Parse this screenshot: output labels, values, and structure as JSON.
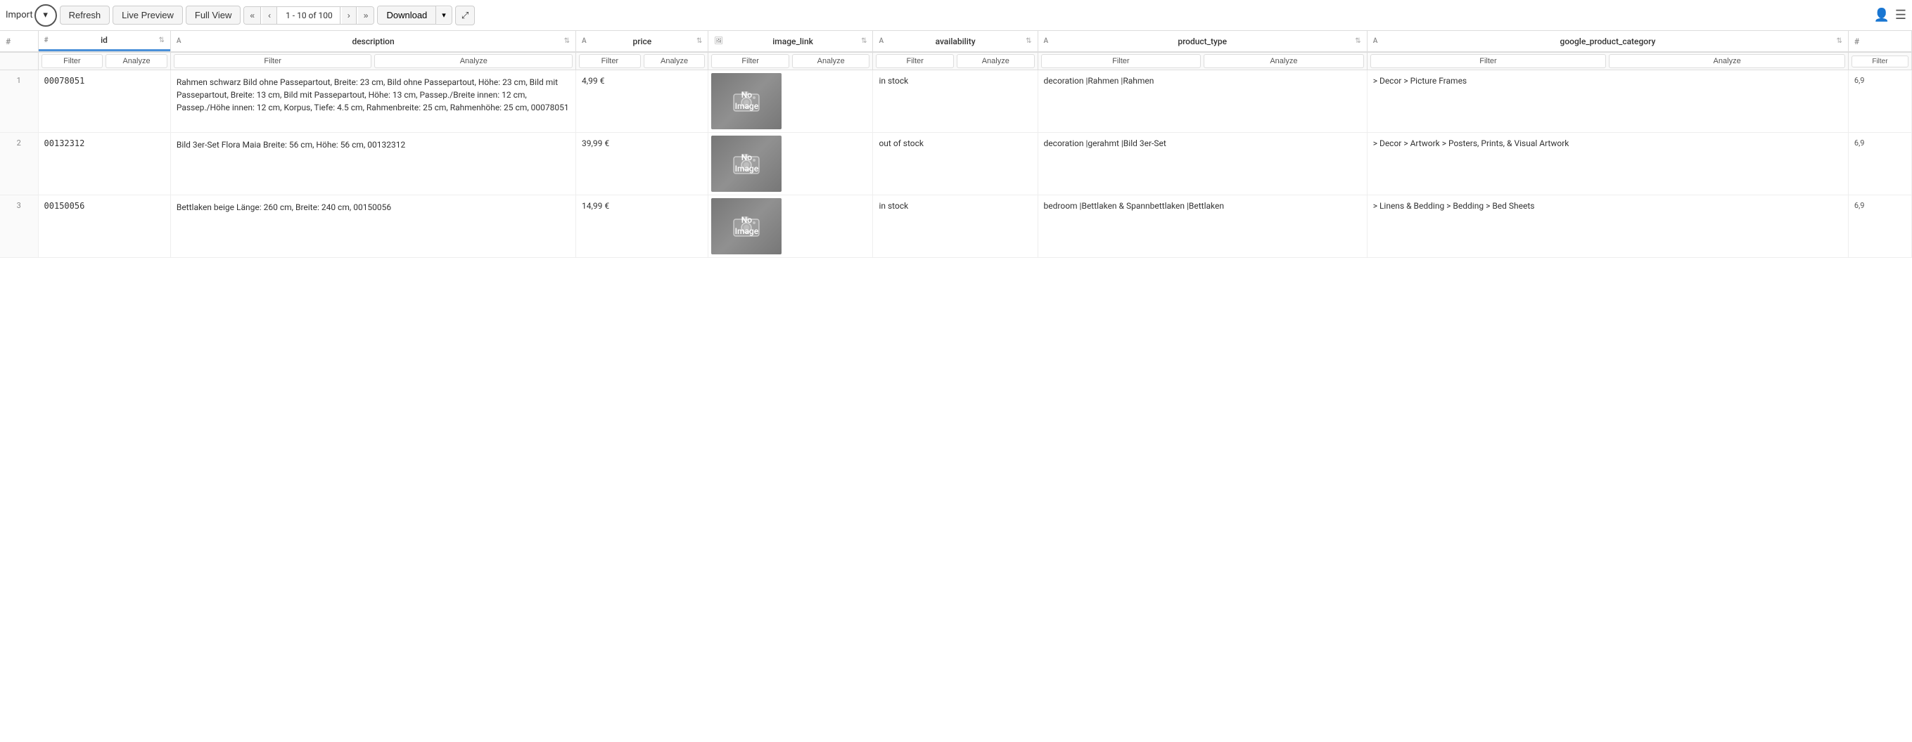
{
  "toolbar": {
    "import_label": "Import",
    "refresh_label": "Refresh",
    "live_preview_label": "Live Preview",
    "full_view_label": "Full View",
    "pagination": {
      "first": "«",
      "prev": "‹",
      "info": "1 - 10 of 100",
      "next": "›",
      "last": "»"
    },
    "download_label": "Download",
    "expand_label": "⤢"
  },
  "columns": [
    {
      "id": "row_num",
      "label": "#",
      "type": "#"
    },
    {
      "id": "id",
      "label": "id",
      "type": "#",
      "active": true
    },
    {
      "id": "description",
      "label": "description",
      "type": "A"
    },
    {
      "id": "price",
      "label": "price",
      "type": "A"
    },
    {
      "id": "image_link",
      "label": "image_link",
      "type": "img"
    },
    {
      "id": "availability",
      "label": "availability",
      "type": "A"
    },
    {
      "id": "product_type",
      "label": "product_type",
      "type": "A"
    },
    {
      "id": "google_product_category",
      "label": "google_product_category",
      "type": "A"
    },
    {
      "id": "last",
      "label": "#",
      "type": "#"
    }
  ],
  "rows": [
    {
      "id": "00078051",
      "description": "Rahmen schwarz Bild ohne Passepartout, Breite: 23 cm, Bild ohne Passepartout, Höhe: 23 cm, Bild mit Passepartout, Breite: 13 cm, Bild mit Passepartout, Höhe: 13 cm, Passep./Breite innen: 12 cm, Passep./Höhe innen: 12 cm, Korpus, Tiefe: 4.5 cm, Rahmenbreite: 25 cm, Rahmenhöhe: 25 cm, 00078051",
      "price": "4,99 €",
      "has_image": false,
      "availability": "in stock",
      "product_type": "decoration |Rahmen |Rahmen",
      "google_product_category": "> Decor > Picture Frames",
      "last_num": "6,9"
    },
    {
      "id": "00132312",
      "description": "Bild 3er-Set Flora Maia Breite: 56 cm, Höhe: 56 cm, 00132312",
      "price": "39,99 €",
      "has_image": false,
      "availability": "out of stock",
      "product_type": "decoration |gerahmt |Bild 3er-Set",
      "google_product_category": "> Decor > Artwork > Posters, Prints, & Visual Artwork",
      "last_num": "6,9"
    },
    {
      "id": "00150056",
      "description": "Bettlaken beige Länge: 260 cm, Breite: 240 cm, 00150056",
      "price": "14,99 €",
      "has_image": false,
      "availability": "in stock",
      "product_type": "bedroom |Bettlaken & Spannbettlaken |Bettlaken",
      "google_product_category": "> Linens & Bedding > Bedding > Bed Sheets",
      "last_num": "6,9"
    }
  ],
  "filter_labels": {
    "filter": "Filter",
    "analyze": "Analyze"
  }
}
